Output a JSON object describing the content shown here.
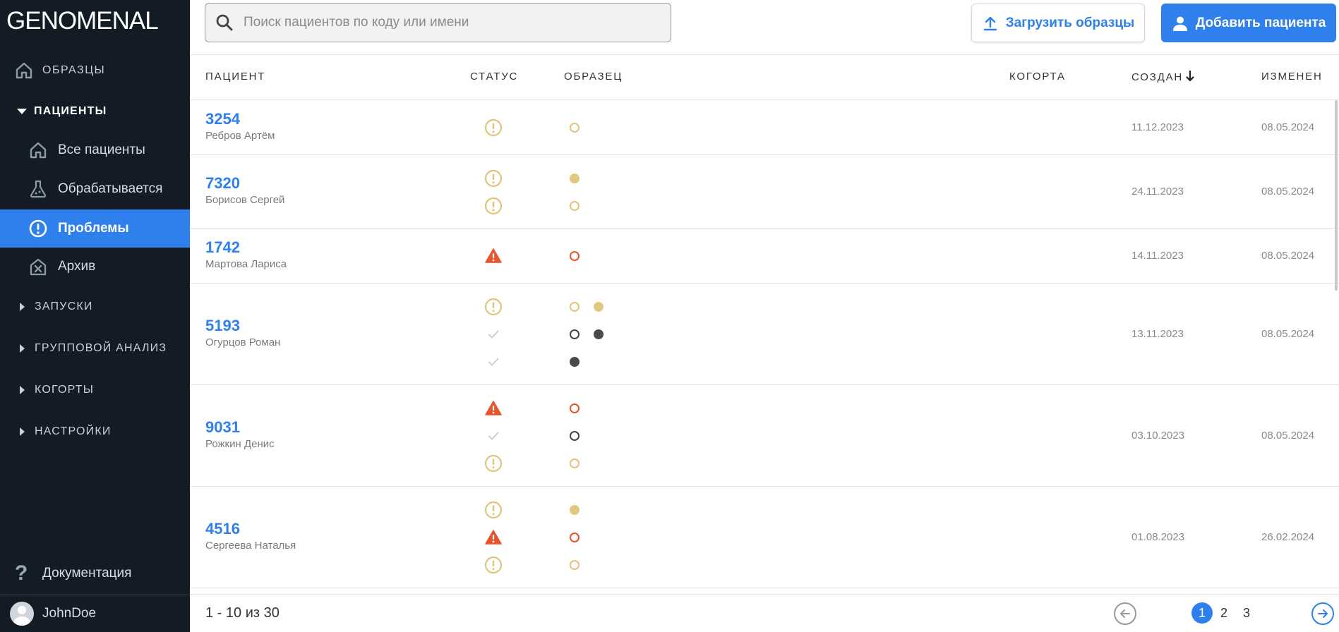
{
  "app": {
    "logo": "GENOMENAL"
  },
  "sidebar": {
    "samples": "ОБРАЗЦЫ",
    "patients_group": "ПАЦИЕНТЫ",
    "patients_items": [
      {
        "label": "Все пациенты",
        "icon": "home-icon"
      },
      {
        "label": "Обрабатывается",
        "icon": "flask-icon"
      },
      {
        "label": "Проблемы",
        "icon": "alert-circle-icon",
        "active": true
      },
      {
        "label": "Архив",
        "icon": "archive-x-icon"
      }
    ],
    "groups": [
      "ЗАПУСКИ",
      "ГРУППОВОЙ АНАЛИЗ",
      "КОГОРТЫ",
      "НАСТРОЙКИ"
    ],
    "docs": "Документация",
    "user": "JohnDoe"
  },
  "topbar": {
    "search_placeholder": "Поиск пациентов по коду или имени",
    "upload_label": "Загрузить образцы",
    "add_label": "Добавить пациента"
  },
  "table": {
    "headers": {
      "patient": "ПАЦИЕНТ",
      "status": "СТАТУС",
      "sample": "ОБРАЗЕЦ",
      "cohort": "КОГОРТА",
      "created": "СОЗДАН",
      "modified": "ИЗМЕНЕН"
    },
    "sort": {
      "column": "created",
      "direction": "desc"
    },
    "rows": [
      {
        "id": "3254",
        "name": "Ребров Артём",
        "created": "11.12.2023",
        "modified": "08.05.2024",
        "lines": [
          {
            "status": "warning",
            "samples": [
              "ring-yellow"
            ]
          }
        ]
      },
      {
        "id": "7320",
        "name": "Борисов Сергей",
        "created": "24.11.2023",
        "modified": "08.05.2024",
        "lines": [
          {
            "status": "warning",
            "samples": [
              "filled-yellow"
            ]
          },
          {
            "status": "warning",
            "samples": [
              "ring-yellow"
            ]
          }
        ]
      },
      {
        "id": "1742",
        "name": "Мартова Лариса",
        "created": "14.11.2023",
        "modified": "08.05.2024",
        "lines": [
          {
            "status": "error",
            "samples": [
              "ring-red"
            ]
          }
        ]
      },
      {
        "id": "5193",
        "name": "Огурцов Роман",
        "created": "13.11.2023",
        "modified": "08.05.2024",
        "lines": [
          {
            "status": "warning",
            "samples": [
              "ring-yellow",
              "filled-yellow"
            ]
          },
          {
            "status": "done",
            "samples": [
              "ring-dark",
              "filled-dark"
            ]
          },
          {
            "status": "done",
            "samples": [
              "filled-dark"
            ]
          }
        ]
      },
      {
        "id": "9031",
        "name": "Рожкин Денис",
        "created": "03.10.2023",
        "modified": "08.05.2024",
        "lines": [
          {
            "status": "error",
            "samples": [
              "ring-red"
            ]
          },
          {
            "status": "done",
            "samples": [
              "ring-dark"
            ]
          },
          {
            "status": "warning",
            "samples": [
              "ring-yellow"
            ]
          }
        ]
      },
      {
        "id": "4516",
        "name": "Сергеева Наталья",
        "created": "01.08.2023",
        "modified": "26.02.2024",
        "lines": [
          {
            "status": "warning",
            "samples": [
              "filled-yellow"
            ]
          },
          {
            "status": "error",
            "samples": [
              "ring-red"
            ]
          },
          {
            "status": "warning",
            "samples": [
              "ring-yellow"
            ]
          }
        ]
      }
    ]
  },
  "pagination": {
    "info": "1 - 10 из 30",
    "pages": [
      "1",
      "2",
      "3"
    ],
    "current": "1"
  },
  "colors": {
    "accent": "#2f80ed",
    "sidebar_bg": "#131c24",
    "warning": "#e0c47a",
    "error": "#e8542b",
    "done": "#c4c4c4"
  }
}
